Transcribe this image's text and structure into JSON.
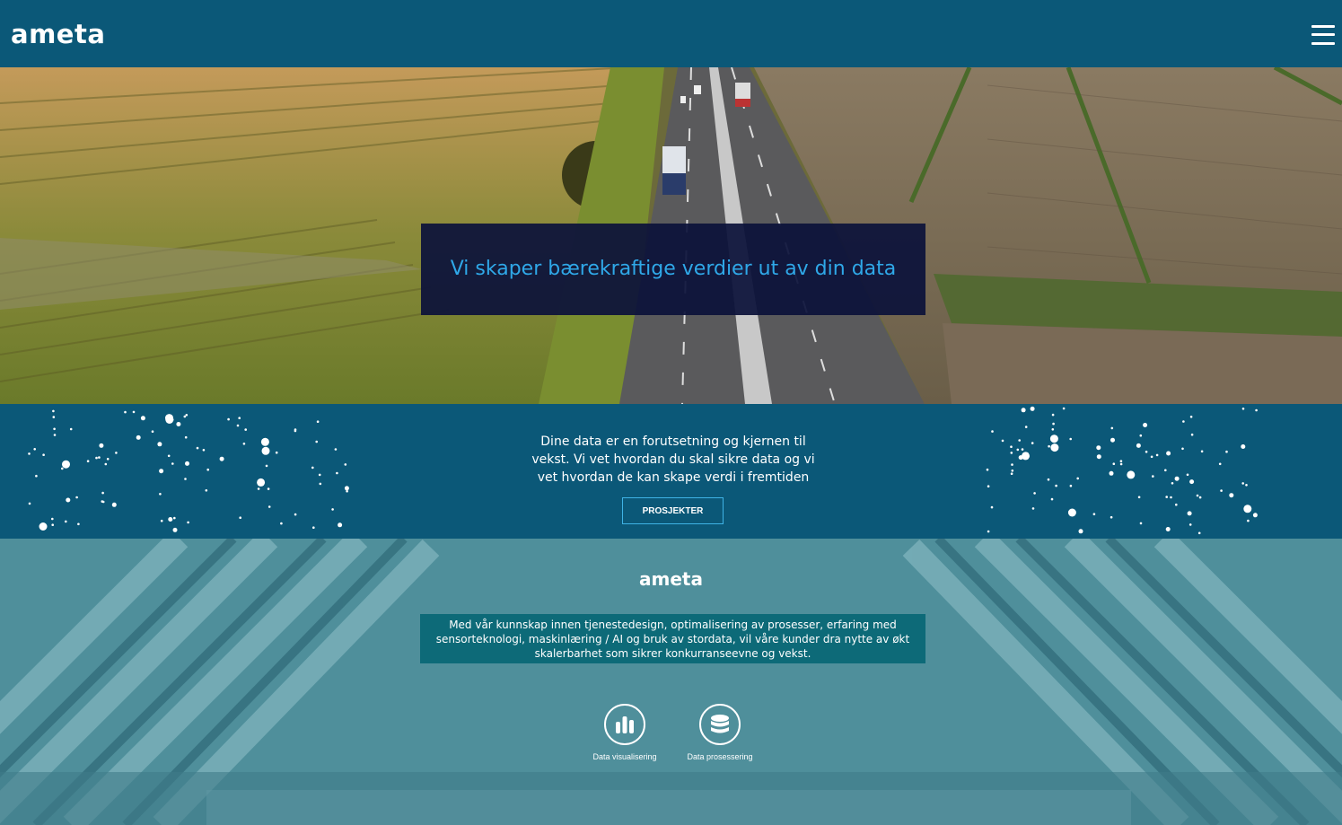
{
  "header": {
    "logo": "ameta",
    "menu_icon": "hamburger-menu-icon"
  },
  "hero": {
    "title": "Vi skaper bærekraftige verdier ut av din data"
  },
  "band": {
    "text": "Dine data er en forutsetning og kjernen til vekst. Vi vet hvordan du skal sikre data og vi vet hvordan de kan skape verdi i fremtiden",
    "button_label": "PROSJEKTER"
  },
  "about": {
    "logo": "ameta",
    "text": "Med vår kunnskap innen tjenestedesign, optimalisering av prosesser, erfaring med sensorteknologi, maskinlæring / AI og bruk av stordata, vil våre kunder dra nytte av økt skalerbarhet som sikrer konkurranseevne og vekst."
  },
  "features": [
    {
      "label": "Data visualisering",
      "icon": "bar-chart-icon"
    },
    {
      "label": "Data prosessering",
      "icon": "database-icon"
    }
  ],
  "colors": {
    "header_bg": "#0b5878",
    "hero_title": "#2fa8e8",
    "hero_box_bg": "#0c123a",
    "button_border": "#3fb3e6",
    "info_box_bg": "#0d6a78"
  }
}
